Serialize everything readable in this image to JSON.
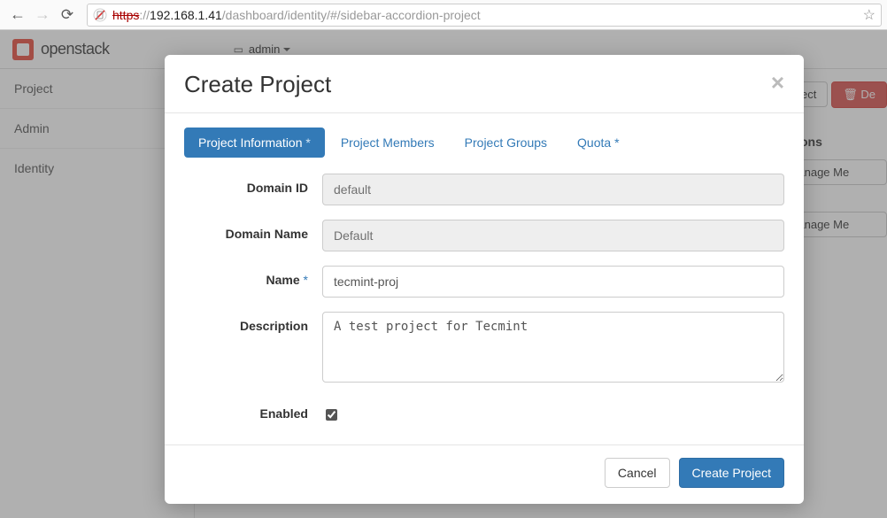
{
  "browser": {
    "address_scheme": "https",
    "address_sep": "://",
    "address_host": "192.168.1.41",
    "address_path": "/dashboard/identity/#/sidebar-accordion-project"
  },
  "topbar": {
    "brand": "openstack",
    "domain_selector": "admin"
  },
  "sidebar": {
    "items": [
      {
        "label": "Project"
      },
      {
        "label": "Admin"
      },
      {
        "label": "Identity"
      }
    ]
  },
  "peek": {
    "create_frag": "roject",
    "delete_frag": "De",
    "actions_header": "Actions",
    "manage_label": "Manage Me"
  },
  "modal": {
    "title": "Create Project",
    "tabs": [
      {
        "label": "Project Information",
        "required": true
      },
      {
        "label": "Project Members",
        "required": false
      },
      {
        "label": "Project Groups",
        "required": false
      },
      {
        "label": "Quota",
        "required": true
      }
    ],
    "fields": {
      "domain_id": {
        "label": "Domain ID",
        "value": "default"
      },
      "domain_name": {
        "label": "Domain Name",
        "value": "Default"
      },
      "name": {
        "label": "Name",
        "value": "tecmint-proj"
      },
      "description": {
        "label": "Description",
        "value": "A test project for Tecmint"
      },
      "enabled": {
        "label": "Enabled",
        "value": true
      }
    },
    "footer": {
      "cancel": "Cancel",
      "submit": "Create Project"
    }
  }
}
